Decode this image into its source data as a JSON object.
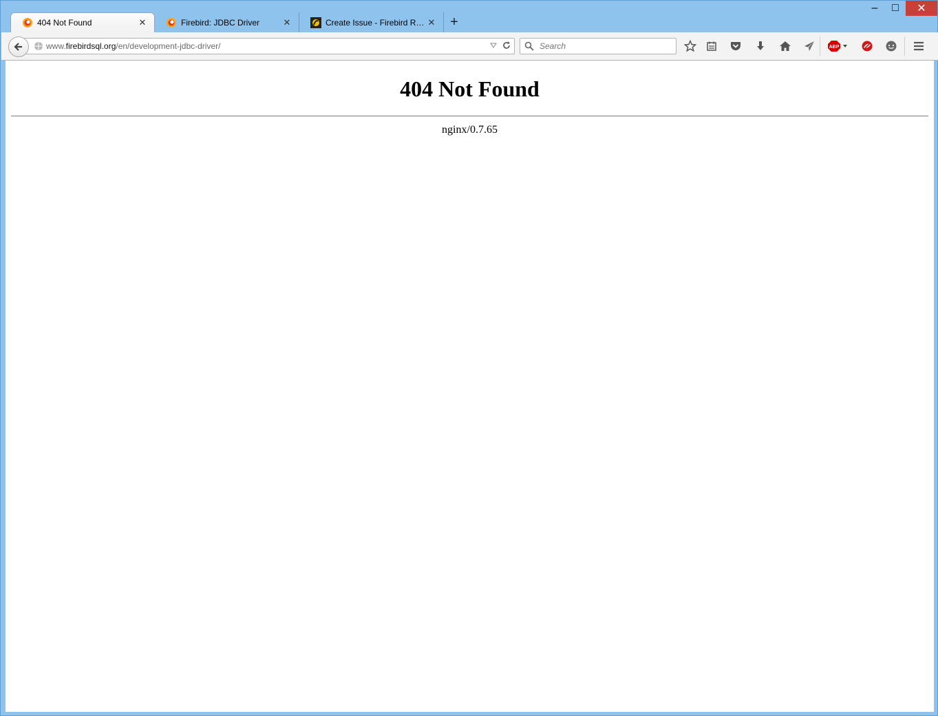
{
  "window": {
    "controls": {
      "minimize": "–",
      "maximize": "□",
      "close": "✕"
    }
  },
  "tabs": [
    {
      "label": "404 Not Found",
      "icon": "firefox-icon",
      "active": true
    },
    {
      "label": "Firebird: JDBC Driver",
      "icon": "firefox-icon",
      "active": false
    },
    {
      "label": "Create Issue - Firebird RDB...",
      "icon": "jira-icon",
      "active": false
    }
  ],
  "newtab_label": "+",
  "address": {
    "host_prefix": "www.",
    "host": "firebirdsql.org",
    "path": "/en/development-jdbc-driver/"
  },
  "search": {
    "placeholder": "Search"
  },
  "toolbar": {
    "icons": [
      "star-icon",
      "reading-list-icon",
      "pocket-icon",
      "download-icon",
      "home-icon",
      "send-icon",
      "adblock-icon",
      "addon-icon",
      "chat-icon",
      "menu-icon"
    ],
    "adblock_text": "ABP"
  },
  "page": {
    "heading": "404 Not Found",
    "server": "nginx/0.7.65"
  },
  "colors": {
    "frame": "#8ec3ee",
    "close": "#c7403a",
    "adblock": "#d50000"
  }
}
